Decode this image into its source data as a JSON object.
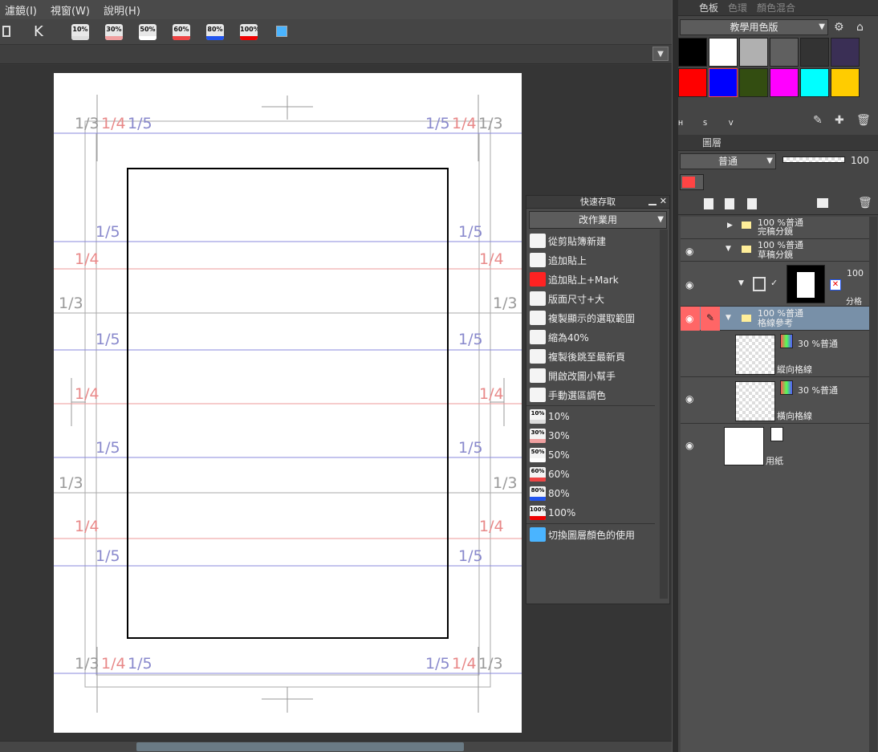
{
  "menu": [
    "濾鏡(I)",
    "視窗(W)",
    "說明(H)"
  ],
  "toolbar": {
    "k_label": "K",
    "opacity_buttons": [
      {
        "label": "10%",
        "color": "#dddddd"
      },
      {
        "label": "30%",
        "color": "#f0a0a0"
      },
      {
        "label": "50%",
        "color": "#ffffff"
      },
      {
        "label": "60%",
        "color": "#ee4444"
      },
      {
        "label": "80%",
        "color": "#2255ee"
      },
      {
        "label": "100%",
        "color": "#ee0000"
      }
    ]
  },
  "guides": {
    "third": "1/3",
    "quarter": "1/4",
    "fifth": "1/5"
  },
  "quick_access": {
    "title": "快速存取",
    "set": "改作業用",
    "items": [
      {
        "label": "從剪貼簿新建",
        "icon": "clipboard-icon"
      },
      {
        "label": "追加貼上",
        "icon": "clipboard-icon"
      },
      {
        "label": "追加貼上+Mark",
        "icon": "red-square-icon"
      },
      {
        "label": "版面尺寸+大",
        "icon": "move-arrows-icon"
      },
      {
        "label": "複製顯示的選取範圍",
        "icon": "copy-page-icon"
      },
      {
        "label": "縮為40%",
        "icon": "scale-40-icon"
      },
      {
        "label": "複製後跳至最新頁",
        "icon": "lock-jump-icon"
      },
      {
        "label": "開啟改圖小幫手",
        "icon": "helper-icon"
      },
      {
        "label": "手動選區調色",
        "icon": "color-select-icon"
      }
    ],
    "opacity_items": [
      {
        "label": "10%",
        "badge": "10%",
        "color": "#dddddd"
      },
      {
        "label": "30%",
        "badge": "30%",
        "color": "#f0a0a0"
      },
      {
        "label": "50%",
        "badge": "50%",
        "color": "#ffffff"
      },
      {
        "label": "60%",
        "badge": "60%",
        "color": "#ee4444"
      },
      {
        "label": "80%",
        "badge": "80%",
        "color": "#2255ee"
      },
      {
        "label": "100%",
        "badge": "100%",
        "color": "#ee0000"
      }
    ],
    "last_item": "切換圖層顏色的使用"
  },
  "palette": {
    "tabs": [
      "色板",
      "色環",
      "顏色混合"
    ],
    "set_name": "教學用色版",
    "colors": [
      "#000000",
      "#ffffff",
      "#b0b0b0",
      "#606060",
      "#333333",
      "#3a2f55",
      "#ff0000",
      "#0000ff",
      "#334d11",
      "#ff00ff",
      "#00ffff",
      "#ffcc00"
    ],
    "hsv": [
      "H",
      "S",
      "V"
    ]
  },
  "layers": {
    "tab": "圖層",
    "blend": "普通",
    "opacity": "100",
    "items": [
      {
        "top": "100 %普通",
        "name": "完稿分鏡"
      },
      {
        "top": "100 %普通",
        "name": "草稿分鏡"
      },
      {
        "top": "100",
        "name": "分格"
      },
      {
        "top": "100 %普通",
        "name": "格線參考"
      },
      {
        "top": "30 %普通",
        "name": "縱向格線"
      },
      {
        "top": "30 %普通",
        "name": "橫向格線"
      },
      {
        "top": "",
        "name": "用紙"
      }
    ]
  }
}
